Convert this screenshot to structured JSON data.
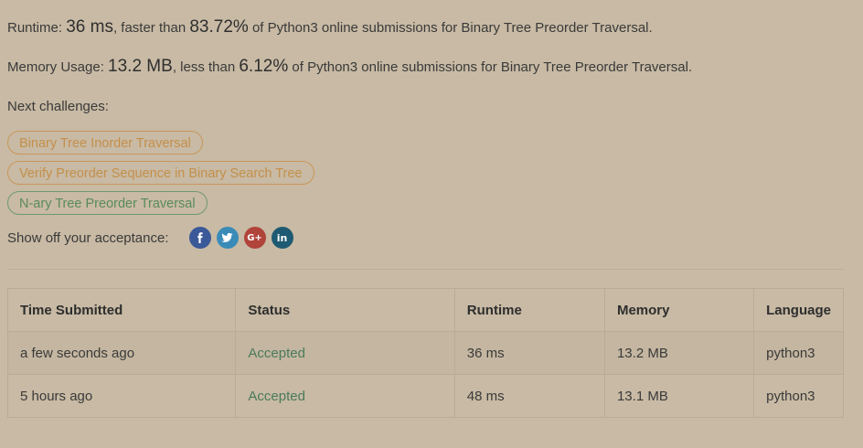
{
  "runtime_line": {
    "label": "Runtime: ",
    "value": "36 ms",
    "mid": ", faster than ",
    "percent": "83.72%",
    "suffix": " of Python3 online submissions for Binary Tree Preorder Traversal."
  },
  "memory_line": {
    "label": "Memory Usage: ",
    "value": "13.2 MB",
    "mid": ", less than ",
    "percent": "6.12%",
    "suffix": " of Python3 online submissions for Binary Tree Preorder Traversal."
  },
  "next_challenges": {
    "label": "Next challenges:",
    "items": [
      {
        "label": "Binary Tree Inorder Traversal",
        "difficulty": "medium"
      },
      {
        "label": "Verify Preorder Sequence in Binary Search Tree",
        "difficulty": "medium"
      },
      {
        "label": "N-ary Tree Preorder Traversal",
        "difficulty": "easy"
      }
    ]
  },
  "share": {
    "label": "Show off your acceptance:",
    "icons": [
      {
        "name": "facebook-icon",
        "color": "#3b5998"
      },
      {
        "name": "twitter-icon",
        "color": "#3a8bb8"
      },
      {
        "name": "google-plus-icon",
        "color": "#b0433a"
      },
      {
        "name": "linkedin-icon",
        "color": "#1f5a73"
      }
    ]
  },
  "submissions": {
    "headers": [
      "Time Submitted",
      "Status",
      "Runtime",
      "Memory",
      "Language"
    ],
    "rows": [
      {
        "time": "a few seconds ago",
        "status": "Accepted",
        "runtime": "36 ms",
        "memory": "13.2 MB",
        "language": "python3"
      },
      {
        "time": "5 hours ago",
        "status": "Accepted",
        "runtime": "48 ms",
        "memory": "13.1 MB",
        "language": "python3"
      }
    ]
  },
  "colors": {
    "background": "#c8baa4",
    "accepted": "#4a7a5a",
    "medium": "#c48f4a",
    "easy": "#5a8a5c"
  }
}
